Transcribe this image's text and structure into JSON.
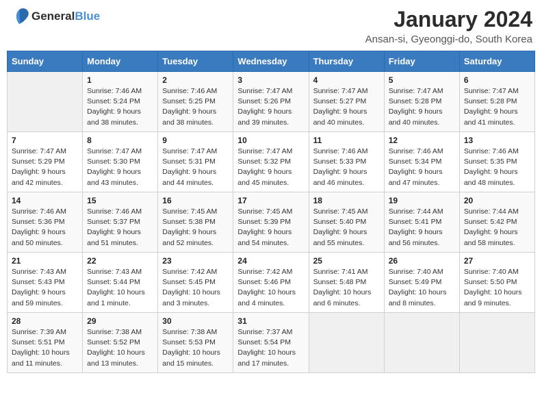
{
  "header": {
    "logo_line1": "General",
    "logo_line2": "Blue",
    "month_title": "January 2024",
    "location": "Ansan-si, Gyeonggi-do, South Korea"
  },
  "weekdays": [
    "Sunday",
    "Monday",
    "Tuesday",
    "Wednesday",
    "Thursday",
    "Friday",
    "Saturday"
  ],
  "weeks": [
    [
      {
        "day": "",
        "sunrise": "",
        "sunset": "",
        "daylight": "",
        "empty": true
      },
      {
        "day": "1",
        "sunrise": "Sunrise: 7:46 AM",
        "sunset": "Sunset: 5:24 PM",
        "daylight": "Daylight: 9 hours and 38 minutes."
      },
      {
        "day": "2",
        "sunrise": "Sunrise: 7:46 AM",
        "sunset": "Sunset: 5:25 PM",
        "daylight": "Daylight: 9 hours and 38 minutes."
      },
      {
        "day": "3",
        "sunrise": "Sunrise: 7:47 AM",
        "sunset": "Sunset: 5:26 PM",
        "daylight": "Daylight: 9 hours and 39 minutes."
      },
      {
        "day": "4",
        "sunrise": "Sunrise: 7:47 AM",
        "sunset": "Sunset: 5:27 PM",
        "daylight": "Daylight: 9 hours and 40 minutes."
      },
      {
        "day": "5",
        "sunrise": "Sunrise: 7:47 AM",
        "sunset": "Sunset: 5:28 PM",
        "daylight": "Daylight: 9 hours and 40 minutes."
      },
      {
        "day": "6",
        "sunrise": "Sunrise: 7:47 AM",
        "sunset": "Sunset: 5:28 PM",
        "daylight": "Daylight: 9 hours and 41 minutes."
      }
    ],
    [
      {
        "day": "7",
        "sunrise": "Sunrise: 7:47 AM",
        "sunset": "Sunset: 5:29 PM",
        "daylight": "Daylight: 9 hours and 42 minutes."
      },
      {
        "day": "8",
        "sunrise": "Sunrise: 7:47 AM",
        "sunset": "Sunset: 5:30 PM",
        "daylight": "Daylight: 9 hours and 43 minutes."
      },
      {
        "day": "9",
        "sunrise": "Sunrise: 7:47 AM",
        "sunset": "Sunset: 5:31 PM",
        "daylight": "Daylight: 9 hours and 44 minutes."
      },
      {
        "day": "10",
        "sunrise": "Sunrise: 7:47 AM",
        "sunset": "Sunset: 5:32 PM",
        "daylight": "Daylight: 9 hours and 45 minutes."
      },
      {
        "day": "11",
        "sunrise": "Sunrise: 7:46 AM",
        "sunset": "Sunset: 5:33 PM",
        "daylight": "Daylight: 9 hours and 46 minutes."
      },
      {
        "day": "12",
        "sunrise": "Sunrise: 7:46 AM",
        "sunset": "Sunset: 5:34 PM",
        "daylight": "Daylight: 9 hours and 47 minutes."
      },
      {
        "day": "13",
        "sunrise": "Sunrise: 7:46 AM",
        "sunset": "Sunset: 5:35 PM",
        "daylight": "Daylight: 9 hours and 48 minutes."
      }
    ],
    [
      {
        "day": "14",
        "sunrise": "Sunrise: 7:46 AM",
        "sunset": "Sunset: 5:36 PM",
        "daylight": "Daylight: 9 hours and 50 minutes."
      },
      {
        "day": "15",
        "sunrise": "Sunrise: 7:46 AM",
        "sunset": "Sunset: 5:37 PM",
        "daylight": "Daylight: 9 hours and 51 minutes."
      },
      {
        "day": "16",
        "sunrise": "Sunrise: 7:45 AM",
        "sunset": "Sunset: 5:38 PM",
        "daylight": "Daylight: 9 hours and 52 minutes."
      },
      {
        "day": "17",
        "sunrise": "Sunrise: 7:45 AM",
        "sunset": "Sunset: 5:39 PM",
        "daylight": "Daylight: 9 hours and 54 minutes."
      },
      {
        "day": "18",
        "sunrise": "Sunrise: 7:45 AM",
        "sunset": "Sunset: 5:40 PM",
        "daylight": "Daylight: 9 hours and 55 minutes."
      },
      {
        "day": "19",
        "sunrise": "Sunrise: 7:44 AM",
        "sunset": "Sunset: 5:41 PM",
        "daylight": "Daylight: 9 hours and 56 minutes."
      },
      {
        "day": "20",
        "sunrise": "Sunrise: 7:44 AM",
        "sunset": "Sunset: 5:42 PM",
        "daylight": "Daylight: 9 hours and 58 minutes."
      }
    ],
    [
      {
        "day": "21",
        "sunrise": "Sunrise: 7:43 AM",
        "sunset": "Sunset: 5:43 PM",
        "daylight": "Daylight: 9 hours and 59 minutes."
      },
      {
        "day": "22",
        "sunrise": "Sunrise: 7:43 AM",
        "sunset": "Sunset: 5:44 PM",
        "daylight": "Daylight: 10 hours and 1 minute."
      },
      {
        "day": "23",
        "sunrise": "Sunrise: 7:42 AM",
        "sunset": "Sunset: 5:45 PM",
        "daylight": "Daylight: 10 hours and 3 minutes."
      },
      {
        "day": "24",
        "sunrise": "Sunrise: 7:42 AM",
        "sunset": "Sunset: 5:46 PM",
        "daylight": "Daylight: 10 hours and 4 minutes."
      },
      {
        "day": "25",
        "sunrise": "Sunrise: 7:41 AM",
        "sunset": "Sunset: 5:48 PM",
        "daylight": "Daylight: 10 hours and 6 minutes."
      },
      {
        "day": "26",
        "sunrise": "Sunrise: 7:40 AM",
        "sunset": "Sunset: 5:49 PM",
        "daylight": "Daylight: 10 hours and 8 minutes."
      },
      {
        "day": "27",
        "sunrise": "Sunrise: 7:40 AM",
        "sunset": "Sunset: 5:50 PM",
        "daylight": "Daylight: 10 hours and 9 minutes."
      }
    ],
    [
      {
        "day": "28",
        "sunrise": "Sunrise: 7:39 AM",
        "sunset": "Sunset: 5:51 PM",
        "daylight": "Daylight: 10 hours and 11 minutes."
      },
      {
        "day": "29",
        "sunrise": "Sunrise: 7:38 AM",
        "sunset": "Sunset: 5:52 PM",
        "daylight": "Daylight: 10 hours and 13 minutes."
      },
      {
        "day": "30",
        "sunrise": "Sunrise: 7:38 AM",
        "sunset": "Sunset: 5:53 PM",
        "daylight": "Daylight: 10 hours and 15 minutes."
      },
      {
        "day": "31",
        "sunrise": "Sunrise: 7:37 AM",
        "sunset": "Sunset: 5:54 PM",
        "daylight": "Daylight: 10 hours and 17 minutes."
      },
      {
        "day": "",
        "sunrise": "",
        "sunset": "",
        "daylight": "",
        "empty": true
      },
      {
        "day": "",
        "sunrise": "",
        "sunset": "",
        "daylight": "",
        "empty": true
      },
      {
        "day": "",
        "sunrise": "",
        "sunset": "",
        "daylight": "",
        "empty": true
      }
    ]
  ]
}
